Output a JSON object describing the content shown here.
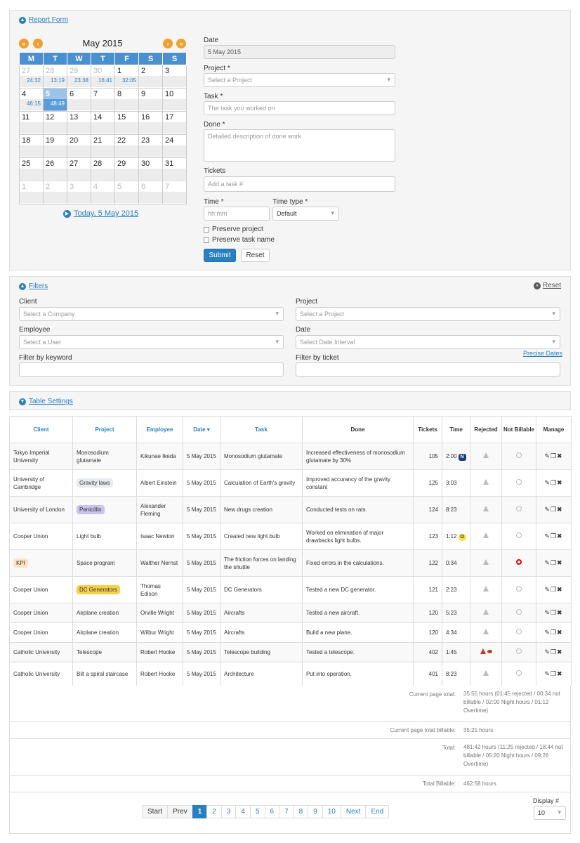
{
  "report_form": {
    "title": "Report Form",
    "calendar": {
      "month_label": "May 2015",
      "weekdays": [
        "M",
        "T",
        "W",
        "T",
        "F",
        "S",
        "S"
      ],
      "weeks": [
        [
          {
            "d": "27",
            "t": "24:32",
            "om": true
          },
          {
            "d": "28",
            "t": "13:19",
            "om": true
          },
          {
            "d": "29",
            "t": "23:38",
            "om": true
          },
          {
            "d": "30",
            "t": "16:41",
            "om": true
          },
          {
            "d": "1",
            "t": "32:05"
          },
          {
            "d": "2",
            "t": ""
          },
          {
            "d": "3",
            "t": ""
          }
        ],
        [
          {
            "d": "4",
            "t": "46:15"
          },
          {
            "d": "5",
            "t": "48:49",
            "sel": true
          },
          {
            "d": "6",
            "t": ""
          },
          {
            "d": "7",
            "t": ""
          },
          {
            "d": "8",
            "t": ""
          },
          {
            "d": "9",
            "t": ""
          },
          {
            "d": "10",
            "t": ""
          }
        ],
        [
          {
            "d": "11",
            "t": ""
          },
          {
            "d": "12",
            "t": ""
          },
          {
            "d": "13",
            "t": ""
          },
          {
            "d": "14",
            "t": ""
          },
          {
            "d": "15",
            "t": ""
          },
          {
            "d": "16",
            "t": ""
          },
          {
            "d": "17",
            "t": ""
          }
        ],
        [
          {
            "d": "18",
            "t": ""
          },
          {
            "d": "19",
            "t": ""
          },
          {
            "d": "20",
            "t": ""
          },
          {
            "d": "21",
            "t": ""
          },
          {
            "d": "22",
            "t": ""
          },
          {
            "d": "23",
            "t": ""
          },
          {
            "d": "24",
            "t": ""
          }
        ],
        [
          {
            "d": "25",
            "t": ""
          },
          {
            "d": "26",
            "t": ""
          },
          {
            "d": "27",
            "t": ""
          },
          {
            "d": "28",
            "t": ""
          },
          {
            "d": "29",
            "t": ""
          },
          {
            "d": "30",
            "t": ""
          },
          {
            "d": "31",
            "t": ""
          }
        ],
        [
          {
            "d": "1",
            "t": "",
            "om": true
          },
          {
            "d": "2",
            "t": "",
            "om": true
          },
          {
            "d": "3",
            "t": "",
            "om": true
          },
          {
            "d": "4",
            "t": "",
            "om": true
          },
          {
            "d": "5",
            "t": "",
            "om": true
          },
          {
            "d": "6",
            "t": "",
            "om": true
          },
          {
            "d": "7",
            "t": "",
            "om": true
          }
        ]
      ],
      "today_link": "Today, 5 May 2015"
    },
    "date_label": "Date",
    "date_value": "5 May 2015",
    "project_label": "Project *",
    "project_placeholder": "Select a Project",
    "task_label": "Task *",
    "task_placeholder": "The task you worked on",
    "done_label": "Done *",
    "done_placeholder": "Detailed description of done work",
    "tickets_label": "Tickets",
    "tickets_placeholder": "Add a task #",
    "time_label": "Time *",
    "time_placeholder": "hh:mm",
    "time_type_label": "Time type *",
    "time_type_value": "Default",
    "preserve_project": "Preserve project",
    "preserve_task": "Preserve task name",
    "submit": "Submit",
    "reset": "Reset"
  },
  "filters": {
    "title": "Filters",
    "reset": "Reset",
    "client_label": "Client",
    "client_placeholder": "Select a Company",
    "project_label": "Project",
    "project_placeholder": "Select a Project",
    "employee_label": "Employee",
    "employee_placeholder": "Select a User",
    "date_label": "Date",
    "date_placeholder": "Select Date Interval",
    "precise_dates": "Precise Dates",
    "keyword_label": "Filter by keyword",
    "ticket_label": "Filter by ticket"
  },
  "table_settings": {
    "title": "Table Settings"
  },
  "table": {
    "headers": [
      "Client",
      "Project",
      "Employee",
      "Date",
      "Task",
      "Done",
      "Tickets",
      "Time",
      "Rejected",
      "Not Billable",
      "Manage"
    ],
    "rows": [
      {
        "client": "Tokyo Imperial University",
        "project": "Monosodium glutamate",
        "ptag": "",
        "employee": "Kikunae Ikeda",
        "date": "5 May 2015",
        "task": "Monosodium glutamate",
        "done": "Increased effectiveness of monosodium glutamate by 30%",
        "tickets": "105",
        "time": "2:00",
        "badge": "N",
        "rejected": false,
        "notbill": false
      },
      {
        "client": "University of Cambridge",
        "project": "Gravity laws",
        "ptag": "#e8ecef",
        "employee": "Albert Einstein",
        "date": "5 May 2015",
        "task": "Calculation of Earth's gravity",
        "done": "Improved accurancy of the gravity constant",
        "tickets": "125",
        "time": "3:03",
        "badge": "",
        "rejected": false,
        "notbill": false
      },
      {
        "client": "University of London",
        "project": "Penicillin",
        "ptag": "#c9c3f0",
        "employee": "Alexander Fleming",
        "date": "5 May 2015",
        "task": "New drugs creation",
        "done": "Conducted tests on rats.",
        "tickets": "124",
        "time": "8:23",
        "badge": "",
        "rejected": false,
        "notbill": false
      },
      {
        "client": "Cooper Union",
        "project": "Light bulb",
        "ptag": "",
        "employee": "Isaac Newton",
        "date": "5 May 2015",
        "task": "Created new light bulb",
        "done": "Worked on elimination of major drawbacks light bulbs.",
        "tickets": "123",
        "time": "1:12",
        "badge": "O",
        "rejected": false,
        "notbill": false
      },
      {
        "client": "KPI",
        "ctag": "#fde3c0",
        "project": "Space program",
        "ptag": "",
        "employee": "Walther Nernst",
        "date": "5 May 2015",
        "task": "The friction forces on landing the shuttle",
        "done": "Fixed errors in the calculations.",
        "tickets": "122",
        "time": "0:34",
        "badge": "",
        "rejected": false,
        "notbill": true
      },
      {
        "client": "Cooper Union",
        "project": "DC Generators",
        "ptag": "#f7cf4a",
        "employee": "Thomas Edison",
        "date": "5 May 2015",
        "task": "DC Generators",
        "done": "Tested a new DC generator.",
        "tickets": "121",
        "time": "2:23",
        "badge": "",
        "rejected": false,
        "notbill": false
      },
      {
        "client": "Cooper Union",
        "project": "Airplane creation",
        "ptag": "",
        "employee": "Orville Wright",
        "date": "5 May 2015",
        "task": "Aircrafts",
        "done": "Tested a new aircraft.",
        "tickets": "120",
        "time": "5:23",
        "badge": "",
        "rejected": false,
        "notbill": false
      },
      {
        "client": "Cooper Union",
        "project": "Airplane creation",
        "ptag": "",
        "employee": "Wilbur Wright",
        "date": "5 May 2015",
        "task": "Aircrafts",
        "done": "Build a new plane.",
        "tickets": "120",
        "time": "4:34",
        "badge": "",
        "rejected": false,
        "notbill": false
      },
      {
        "client": "Catholic University",
        "project": "Telescope",
        "ptag": "",
        "employee": "Robert Hooke",
        "date": "5 May 2015",
        "task": "Telescope building",
        "done": "Tested a telescope.",
        "tickets": "402",
        "time": "1:45",
        "badge": "",
        "rejected": true,
        "notbill": false
      },
      {
        "client": "Catholic University",
        "project": "Bilt a spiral staircase",
        "ptag": "",
        "employee": "Robert Hooke",
        "date": "5 May 2015",
        "task": "Architecture",
        "done": "Put into operation.",
        "tickets": "401",
        "time": "8:23",
        "badge": "",
        "rejected": false,
        "notbill": false
      }
    ]
  },
  "totals": {
    "page_total_label": "Current page total:",
    "page_total_value": "35:55 hours (01:45 rejected / 00:34 not billable / 02:00 Night hours / 01:12 Overtime)",
    "page_billable_label": "Current page total billable:",
    "page_billable_value": "35:21 hours",
    "total_label": "Total:",
    "total_value": "481:42 hours (11:25 rejected / 18:44 not billable / 05:20 Night hours / 09:26 Overtime)",
    "total_billable_label": "Total Billable:",
    "total_billable_value": "462:58 hours"
  },
  "pagination": {
    "start": "Start",
    "prev": "Prev",
    "pages": [
      "1",
      "2",
      "3",
      "4",
      "5",
      "6",
      "7",
      "8",
      "9",
      "10"
    ],
    "next": "Next",
    "end": "End",
    "display_label": "Display #",
    "display_value": "10"
  },
  "colors": {
    "accent": "#2a7fc1",
    "nav_orange": "#f0a030",
    "calendar_header": "#4a8fd0"
  }
}
